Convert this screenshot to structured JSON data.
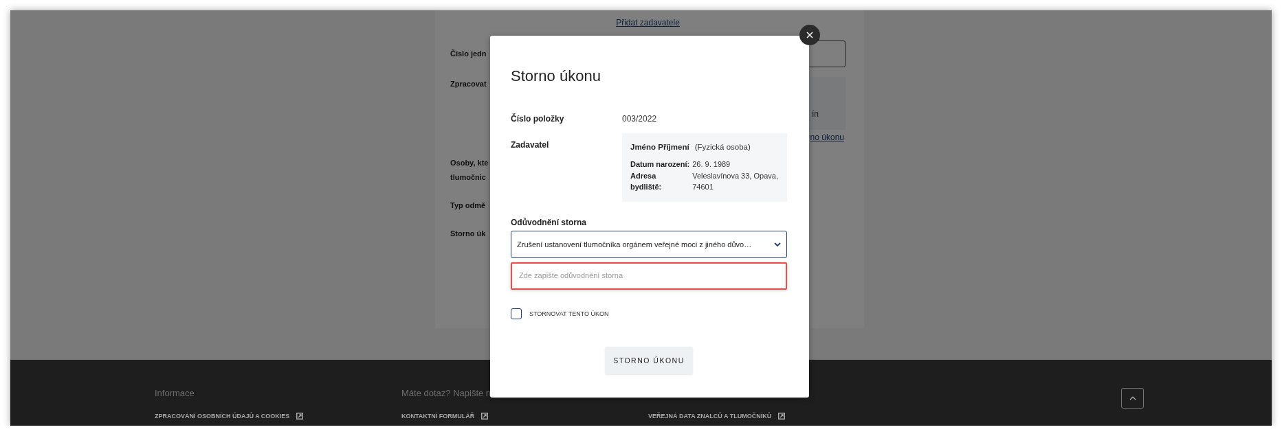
{
  "background_form": {
    "add_link": "Přidat zadavatele",
    "rows": [
      {
        "kind": "input",
        "label": "Číslo jedn"
      },
      {
        "kind": "info",
        "label": "Zpracovat",
        "value": "ín",
        "link": "no úkonu"
      },
      {
        "kind": "plain",
        "label": "Osoby, kte\ntlumočnic"
      },
      {
        "kind": "plain",
        "label": "Typ odmě"
      },
      {
        "kind": "plain",
        "label": "Storno úk"
      }
    ]
  },
  "modal": {
    "title": "Storno úkonu",
    "fields": [
      {
        "kind": "text",
        "label": "Číslo položky",
        "value": "003/2022"
      },
      {
        "kind": "person",
        "label": "Zadavatel",
        "name": "Jméno Příjmení",
        "type": "(Fyzická osoba)",
        "details": [
          {
            "label": "Datum narození:",
            "value": "26. 9. 1989"
          },
          {
            "label": "Adresa bydliště:",
            "value": "Veleslavínova 33, Opava, 74601"
          }
        ]
      }
    ],
    "reason": {
      "label": "Odůvodnění storna",
      "value": "Zrušení ustanovení tlumočníka orgánem veřejné moci z jiného důvo…",
      "placeholder": "Zde zapište odůvodnění storna",
      "invalid": true
    },
    "checkbox": {
      "label": "STORNOVAT TENTO ÚKON",
      "checked": false
    },
    "button": "STORNO ÚKONU"
  },
  "footer": {
    "columns": [
      {
        "heading": "Informace",
        "link": "ZPRACOVÁNÍ OSOBNÍCH ÚDAJŮ A COOKIES"
      },
      {
        "heading": "Máte dotaz? Napište n",
        "link": "KONTAKTNÍ FORMULÁŘ"
      },
      {
        "link": "VEŘEJNÁ DATA ZNALCŮ A TLUMOČNÍKŮ"
      }
    ]
  }
}
